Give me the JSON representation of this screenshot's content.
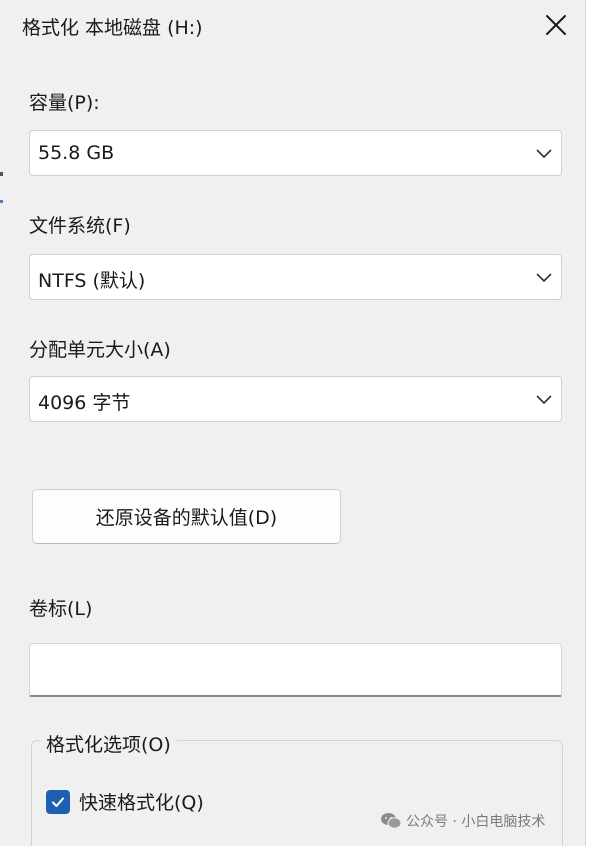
{
  "window": {
    "title": "格式化 本地磁盘 (H:)",
    "close_icon": "close-icon"
  },
  "capacity": {
    "label": "容量(P):",
    "value": "55.8 GB"
  },
  "file_system": {
    "label": "文件系统(F)",
    "value": "NTFS (默认)"
  },
  "allocation_unit": {
    "label": "分配单元大小(A)",
    "value": "4096 字节"
  },
  "restore_button": {
    "label": "还原设备的默认值(D)"
  },
  "volume_label": {
    "label": "卷标(L)",
    "value": ""
  },
  "format_options": {
    "legend": "格式化选项(O)",
    "quick_format": {
      "label": "快速格式化(Q)",
      "checked": true
    }
  },
  "watermark": {
    "text": "公众号 · 小白电脑技术",
    "icon": "wechat-icon"
  },
  "colors": {
    "background": "#f0f0f0",
    "accent": "#1e5fb4",
    "field_background": "#ffffff"
  }
}
